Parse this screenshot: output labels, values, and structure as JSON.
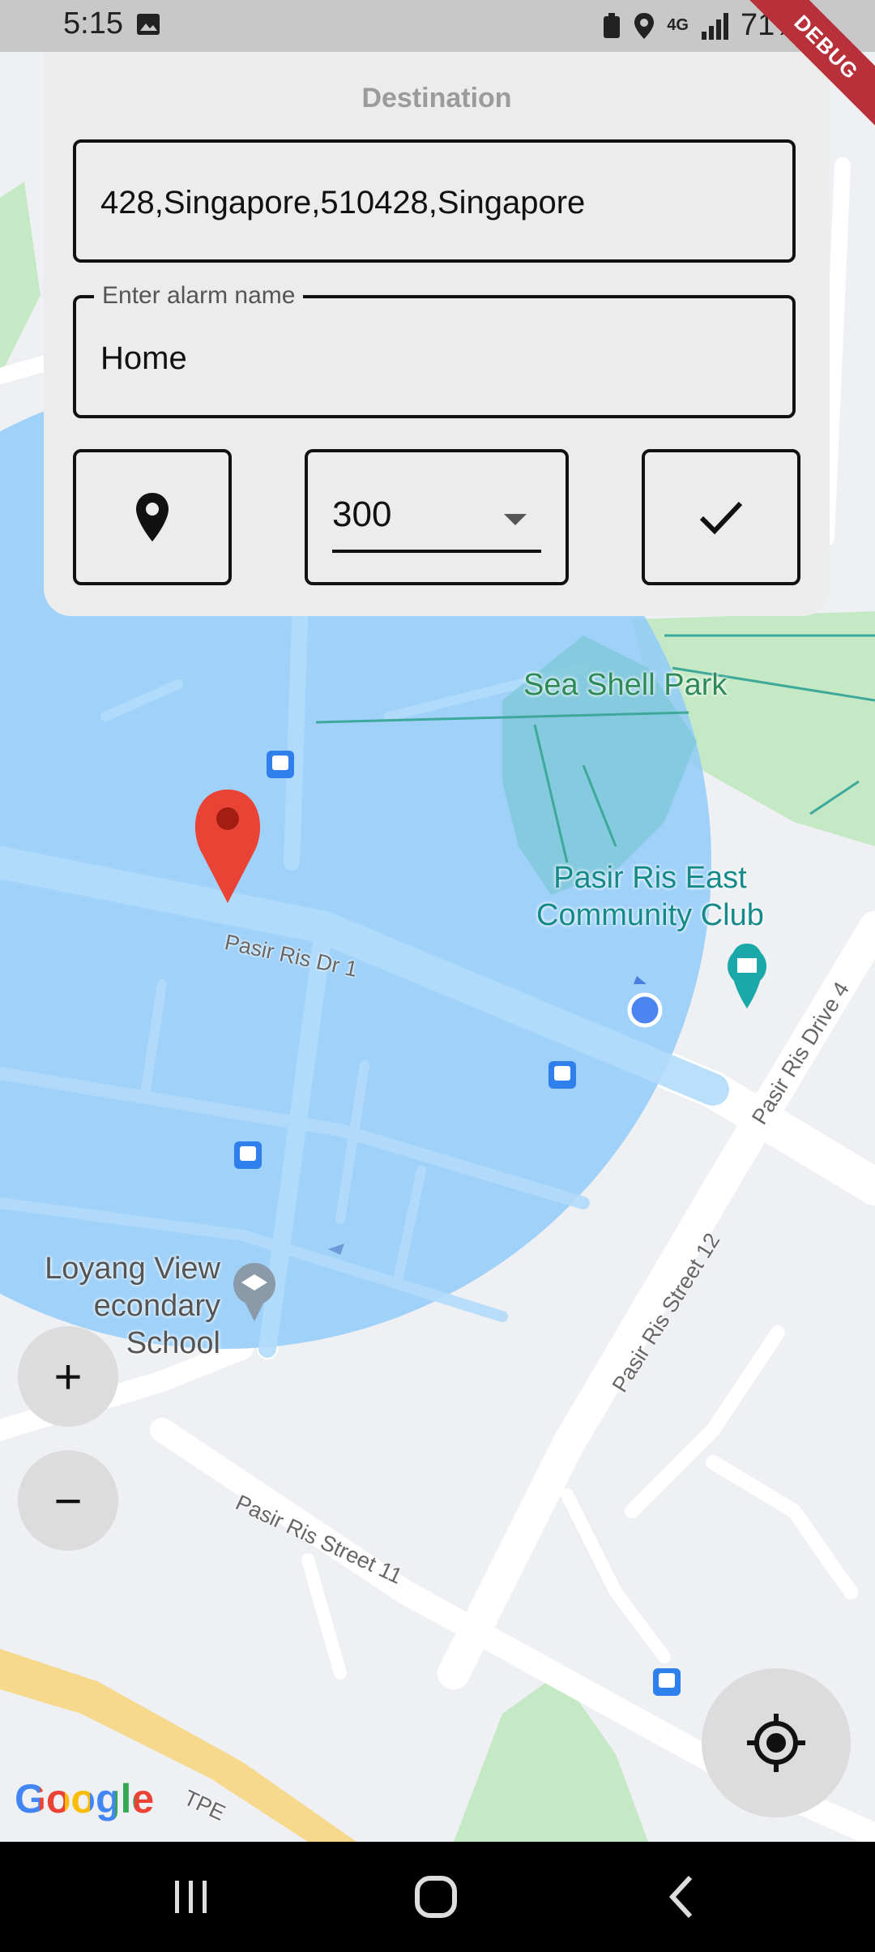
{
  "status": {
    "time": "5:15",
    "battery": "71%",
    "network": "4G",
    "debug_banner": "DEBUG"
  },
  "panel": {
    "title": "Destination",
    "address_value": "428,Singapore,510428,Singapore",
    "alarm_label": "Enter alarm name",
    "alarm_value": "Home",
    "radius_value": "300"
  },
  "map": {
    "labels": {
      "park": "Sea Shell Park",
      "cc_line1": "Pasir Ris East",
      "cc_line2": "Community Club",
      "school_line1": "Loyang View",
      "school_line2": "econdary School",
      "road1": "Pasir Ris Dr 1",
      "road2": "Pasir Ris Drive 4",
      "road3": "Pasir Ris Street 12",
      "road4": "Pasir Ris Street 11",
      "road5": "TPE"
    },
    "zoom_in": "+",
    "zoom_out": "−",
    "google_logo": "Google"
  },
  "colors": {
    "radius_circle": "#90cbf9",
    "marker": "#ea4335",
    "park_green": "#c6e9c5"
  }
}
